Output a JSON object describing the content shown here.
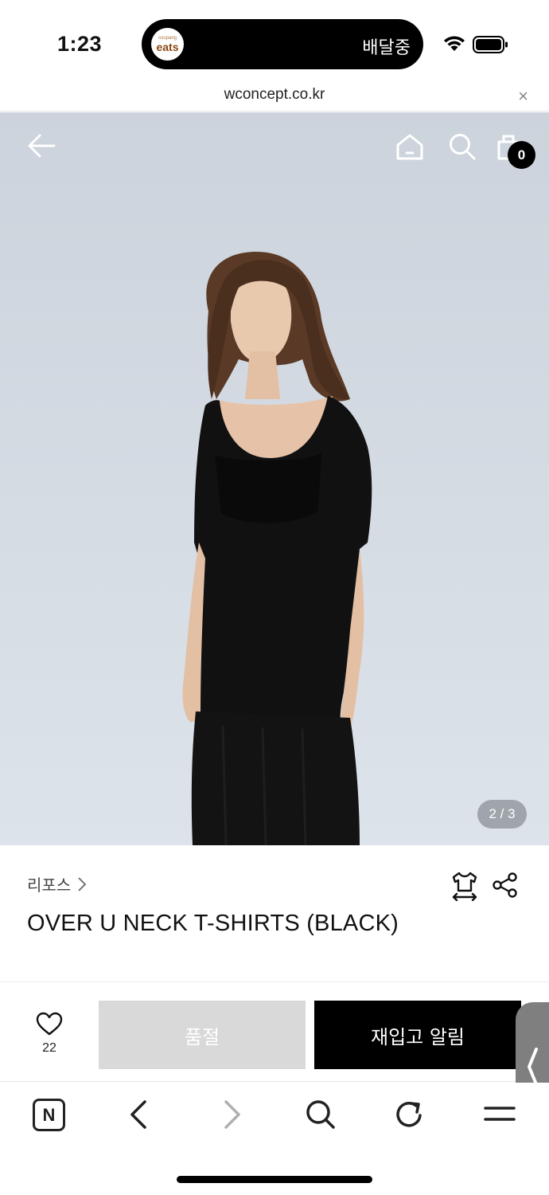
{
  "status_bar": {
    "time": "1:23",
    "live_activity_logo_small": "coupang",
    "live_activity_logo_big": "eats",
    "live_activity_text": "배달중"
  },
  "browser": {
    "url": "wconcept.co.kr",
    "close_label": "×"
  },
  "hero": {
    "cart_count": "0",
    "page_indicator": "2 / 3"
  },
  "product": {
    "brand": "리포스",
    "name": "OVER U NECK T-SHIRTS (BLACK)"
  },
  "actions": {
    "like_count": "22",
    "soldout_label": "품절",
    "restock_label": "재입고 알림"
  },
  "toolbar": {
    "n_label": "N"
  },
  "colors": {
    "primary_button": "#000000",
    "disabled_button": "#d9d9d9",
    "hero_background": "#d8dee6"
  }
}
